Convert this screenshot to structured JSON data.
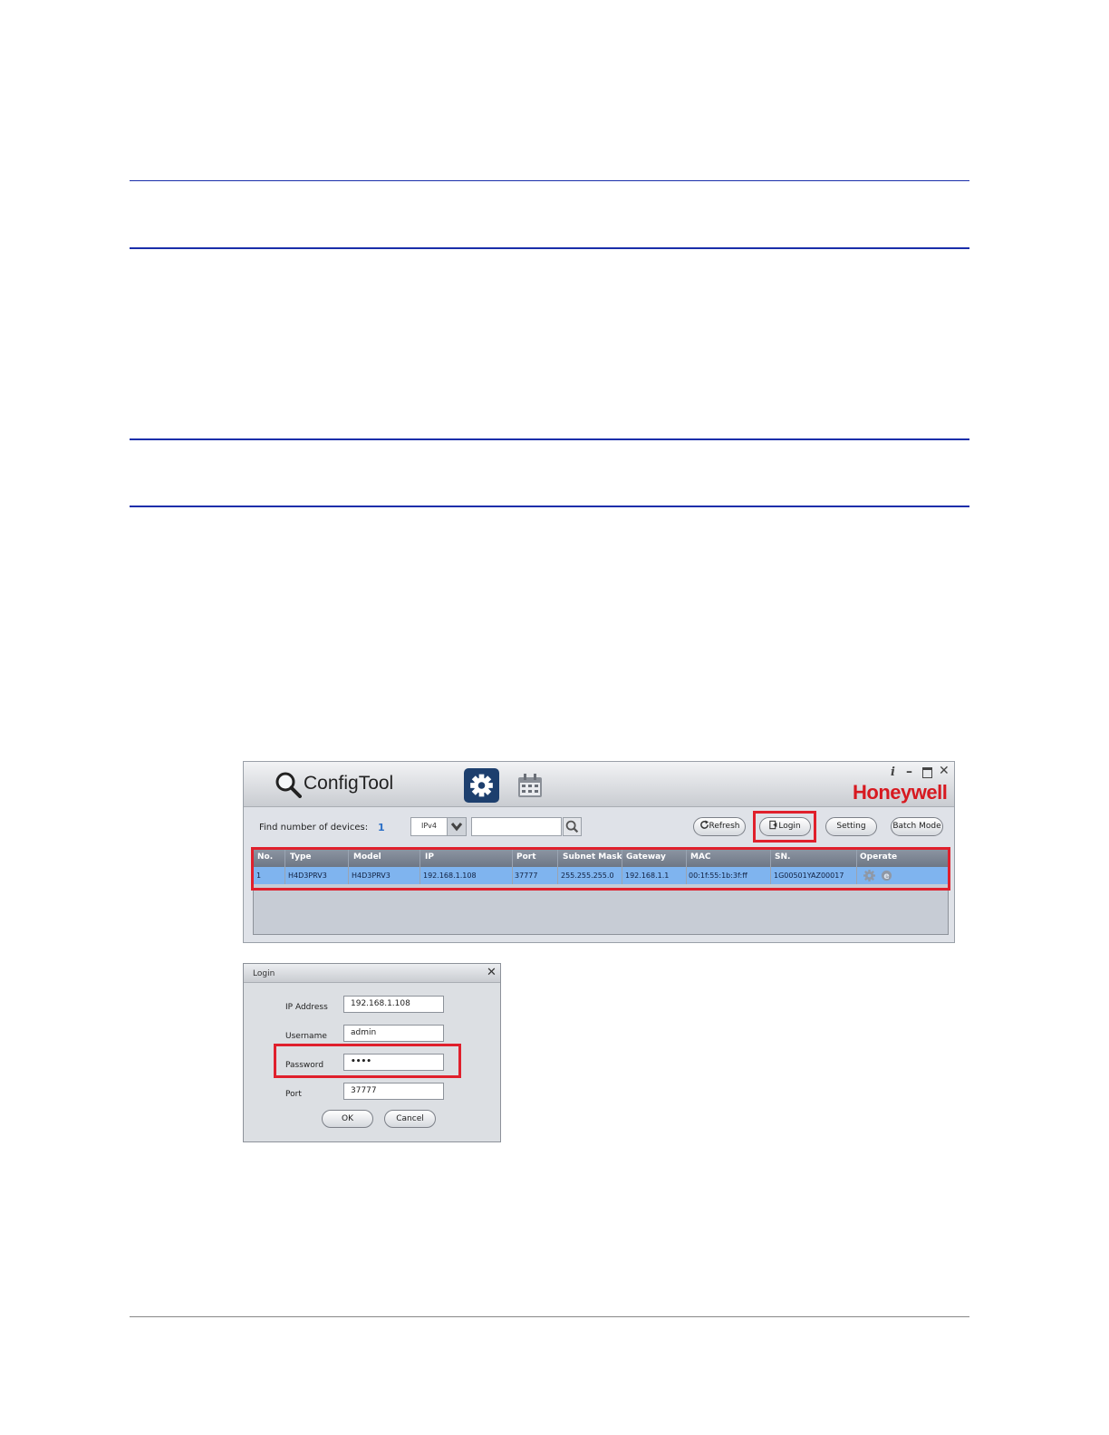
{
  "configtool": {
    "title": "ConfigTool",
    "brand": "Honeywell",
    "window_controls": {
      "info": "i",
      "minimize": "–",
      "close": "✕"
    },
    "find_label": "Find number of devices:",
    "find_count": "1",
    "ip_version": "IPv4",
    "buttons": {
      "refresh": "Refresh",
      "login": "Login",
      "setting": "Setting",
      "batch_mode": "Batch Mode"
    },
    "table": {
      "headers": [
        "No.",
        "Type",
        "Model",
        "IP",
        "Port",
        "Subnet Mask",
        "Gateway",
        "MAC",
        "SN.",
        "Operate"
      ],
      "rows": [
        [
          "1",
          "H4D3PRV3",
          "H4D3PRV3",
          "192.168.1.108",
          "37777",
          "255.255.255.0",
          "192.168.1.1",
          "00:1f:55:1b:3f:ff",
          "1G00501YAZ00017"
        ]
      ]
    }
  },
  "login_dialog": {
    "title": "Login",
    "close": "✕",
    "fields": {
      "ip_label": "IP Address",
      "ip_value": "192.168.1.108",
      "username_label": "Username",
      "username_value": "admin",
      "password_label": "Password",
      "password_value": "••••",
      "port_label": "Port",
      "port_value": "37777"
    },
    "ok": "OK",
    "cancel": "Cancel"
  },
  "colors": {
    "rule": "#1a2eaa",
    "highlight": "#e0202c",
    "brand": "#d71920",
    "selected_row": "#7fb4ef"
  }
}
